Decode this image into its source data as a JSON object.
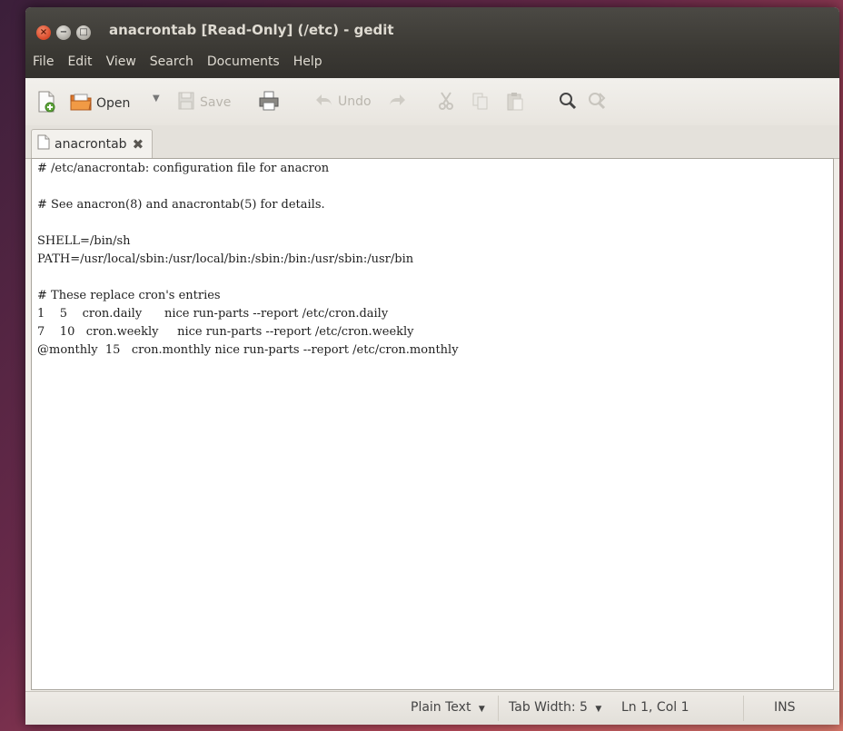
{
  "window": {
    "title": "anacrontab [Read-Only] (/etc) - gedit",
    "controls": {
      "close": "×",
      "minimize": "−",
      "maximize": "□"
    }
  },
  "menubar": {
    "items": [
      "File",
      "Edit",
      "View",
      "Search",
      "Documents",
      "Help"
    ]
  },
  "toolbar": {
    "new_icon": "new-document-icon",
    "open_label": "Open",
    "open_arrow": "▼",
    "save_label": "Save",
    "print_icon": "printer-icon",
    "undo_label": "Undo",
    "redo_icon": "redo-icon",
    "cut_icon": "cut-icon",
    "copy_icon": "copy-icon",
    "paste_icon": "paste-icon",
    "find_icon": "search-icon",
    "replace_icon": "replace-icon"
  },
  "tabs": [
    {
      "label": "anacrontab",
      "close": "✖"
    }
  ],
  "editor": {
    "lines": [
      "# /etc/anacrontab: configuration file for anacron",
      "",
      "# See anacron(8) and anacrontab(5) for details.",
      "",
      "SHELL=/bin/sh",
      "PATH=/usr/local/sbin:/usr/local/bin:/sbin:/bin:/usr/sbin:/usr/bin",
      "",
      "# These replace cron's entries",
      "1    5    cron.daily      nice run-parts --report /etc/cron.daily",
      "7    10   cron.weekly     nice run-parts --report /etc/cron.weekly",
      "@monthly  15   cron.monthly nice run-parts --report /etc/cron.monthly"
    ]
  },
  "statusbar": {
    "language": "Plain Text",
    "language_arrow": "▼",
    "tab_width": "Tab Width: 5",
    "tab_width_arrow": "▼",
    "cursor": "Ln 1, Col 1",
    "mode": "INS"
  },
  "colors": {
    "titlebar": "#3b3934",
    "close_button": "#d94a2a",
    "editor_bg": "#ffffff",
    "desktop": "#6a2a4a"
  }
}
